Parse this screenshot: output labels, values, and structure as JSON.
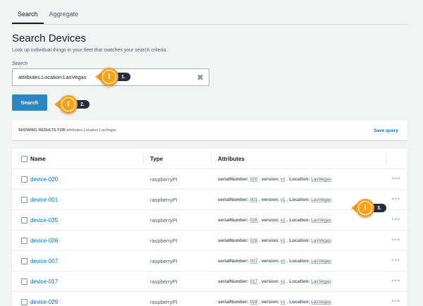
{
  "tabs": [
    {
      "label": "Search",
      "active": true
    },
    {
      "label": "Aggregate",
      "active": false
    }
  ],
  "page": {
    "title": "Search Devices",
    "subtitle": "Look up individual things in your fleet that matches your search criteria."
  },
  "search": {
    "label": "Search",
    "value": "attributes.Location:LasVegas",
    "button_label": "Search"
  },
  "results": {
    "prefix": "SHOWING RESULTS FOR",
    "query": "attributes.Location:LasVegas",
    "save_label": "Save query"
  },
  "table": {
    "headers": {
      "name": "Name",
      "type": "Type",
      "attributes": "Attributes"
    },
    "rows": [
      {
        "name": "device-020",
        "type": "raspberryPI",
        "serial": "020",
        "version": "v1",
        "location": "LasVegas"
      },
      {
        "name": "device-001",
        "type": "raspberryPI",
        "serial": "001",
        "version": "v1",
        "location": "LasVegas"
      },
      {
        "name": "device-035",
        "type": "raspberryPI",
        "serial": "035",
        "version": "v1",
        "location": "LasVegas"
      },
      {
        "name": "device-026",
        "type": "raspberryPI",
        "serial": "026",
        "version": "v1",
        "location": "LasVegas"
      },
      {
        "name": "device-007",
        "type": "raspberryPI",
        "serial": "007",
        "version": "v1",
        "location": "LasVegas"
      },
      {
        "name": "device-017",
        "type": "raspberryPI",
        "serial": "017",
        "version": "v1",
        "location": "LasVegas"
      },
      {
        "name": "device-029",
        "type": "raspberryPI",
        "serial": "029",
        "version": "v1",
        "location": "LasVegas"
      }
    ],
    "attr_keys": {
      "serial": "serialNumber:",
      "version": "version:",
      "location": "Location:"
    },
    "more_glyph": "•••"
  },
  "callouts": [
    {
      "number": "1.",
      "glyph": "!"
    },
    {
      "number": "2.",
      "glyph": "!"
    },
    {
      "number": "3.",
      "glyph": "!"
    }
  ],
  "colors": {
    "accent": "#f7a21b",
    "link": "#0073bb",
    "button": "#2e86c1"
  }
}
